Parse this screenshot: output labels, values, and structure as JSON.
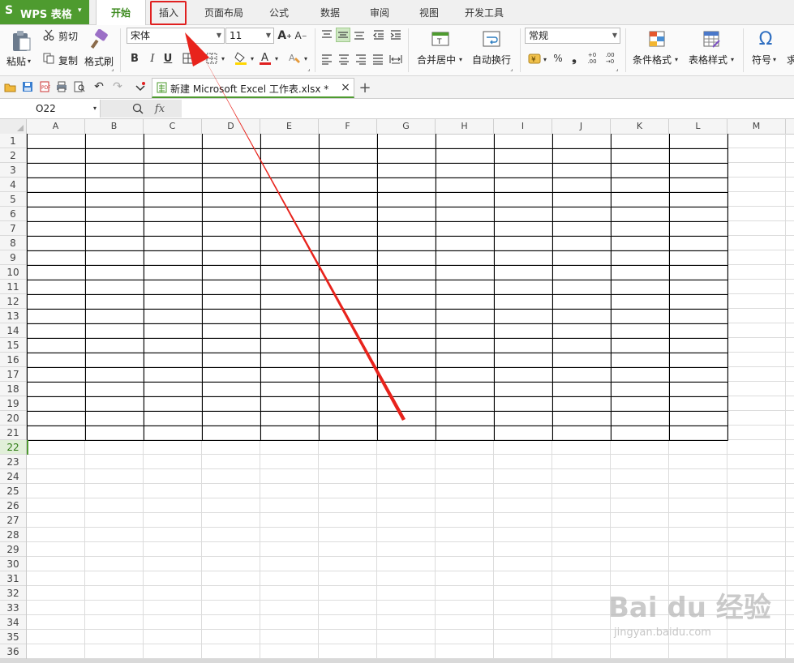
{
  "app": {
    "logo_glyph": "S",
    "title": "WPS 表格",
    "caret": "▾"
  },
  "menu_tabs": [
    {
      "label": "开始",
      "active": true
    },
    {
      "label": "插入",
      "highlighted": true
    },
    {
      "label": "页面布局"
    },
    {
      "label": "公式"
    },
    {
      "label": "数据"
    },
    {
      "label": "审阅"
    },
    {
      "label": "视图"
    },
    {
      "label": "开发工具"
    }
  ],
  "ribbon": {
    "paste": "粘贴",
    "cut": "剪切",
    "copy": "复制",
    "format_painter": "格式刷",
    "font_name": "宋体",
    "font_size": "11",
    "bold": "B",
    "italic": "I",
    "underline": "U",
    "merge_center": "合并居中",
    "wrap_text": "自动换行",
    "number_format": "常规",
    "percent": "%",
    "thousands": "❟",
    "cond_format": "条件格式",
    "table_style": "表格样式",
    "symbol": "符号",
    "more": "求"
  },
  "document_tab": {
    "title": "新建 Microsoft Excel 工作表.xlsx *",
    "close": "×",
    "add": "+"
  },
  "formula_bar": {
    "cell_ref": "O22",
    "fx": "fx",
    "value": ""
  },
  "columns": [
    "A",
    "B",
    "C",
    "D",
    "E",
    "F",
    "G",
    "H",
    "I",
    "J",
    "K",
    "L",
    "M"
  ],
  "rows": [
    "1",
    "2",
    "3",
    "4",
    "5",
    "6",
    "7",
    "8",
    "9",
    "10",
    "11",
    "12",
    "13",
    "14",
    "15",
    "16",
    "17",
    "18",
    "19",
    "20",
    "21",
    "22",
    "23",
    "24",
    "25",
    "26",
    "27",
    "28",
    "29",
    "30",
    "31",
    "32",
    "33",
    "34",
    "35",
    "36"
  ],
  "selected_row": "22",
  "bordered_range": {
    "rows": 21,
    "columns": 12
  },
  "colors": {
    "accent_green": "#4e9b2f",
    "annotation_red": "#e02020",
    "grid_line": "#dcdcdc",
    "table_border": "#000000"
  },
  "watermark": {
    "brand": "Bai du 经验",
    "url": "jingyan.baidu.com"
  }
}
